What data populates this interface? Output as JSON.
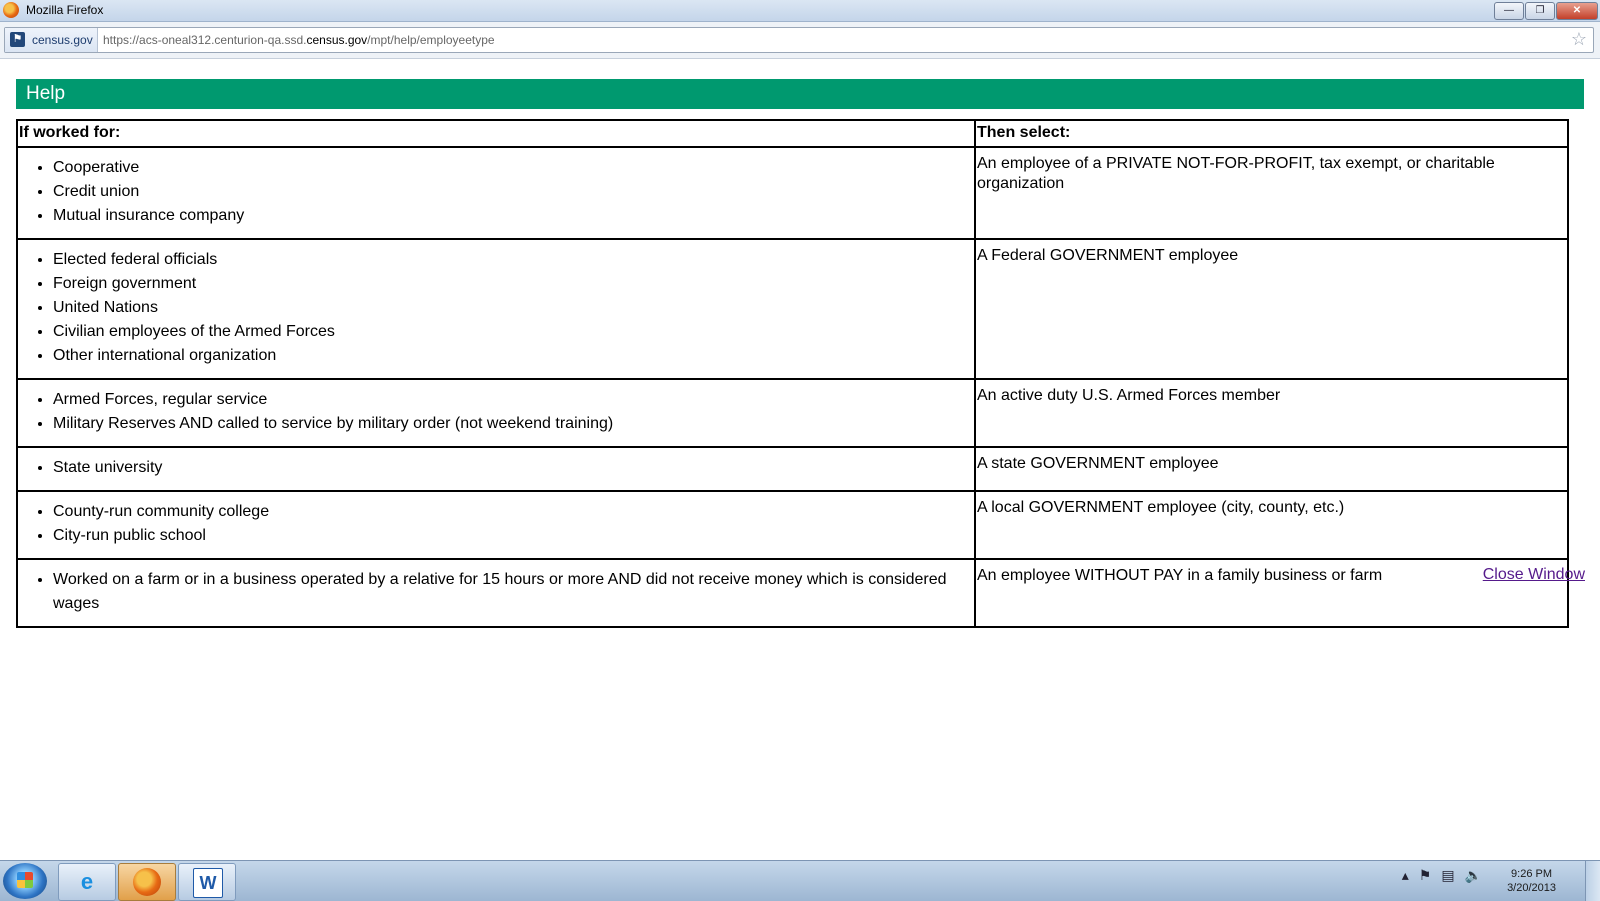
{
  "window": {
    "title": "Mozilla Firefox",
    "controls": {
      "minimize": "—",
      "restore": "❐",
      "close": "✕"
    }
  },
  "browser": {
    "site_identity": "census.gov",
    "url_prefix": "https://acs-oneal312.centurion-qa.ssd.",
    "url_domain": "census.gov",
    "url_path": "/mpt/help/employeetype"
  },
  "page": {
    "header": "Help",
    "table": {
      "col_left": "If worked for:",
      "col_right": "Then select:",
      "rows": [
        {
          "items": [
            "Cooperative",
            "Credit union",
            "Mutual insurance company"
          ],
          "select": "An employee of a PRIVATE NOT-FOR-PROFIT, tax exempt, or charitable organization"
        },
        {
          "items": [
            "Elected federal officials",
            "Foreign government",
            "United Nations",
            "Civilian employees of the Armed Forces",
            "Other international organization"
          ],
          "select": "A Federal GOVERNMENT employee"
        },
        {
          "items": [
            "Armed Forces, regular service",
            "Military Reserves AND called to service by military order (not weekend training)"
          ],
          "select": "An active duty U.S. Armed Forces member"
        },
        {
          "items": [
            "State university"
          ],
          "select": "A state GOVERNMENT employee"
        },
        {
          "items": [
            "County-run community college",
            "City-run public school"
          ],
          "select": "A local GOVERNMENT employee (city, county, etc.)"
        },
        {
          "items": [
            "Worked on a farm or in a business operated by a relative for 15 hours or more AND did not receive money which is considered wages"
          ],
          "select": "An employee WITHOUT PAY in a family business or farm"
        }
      ]
    },
    "close_link": "Close Window"
  },
  "taskbar": {
    "apps": [
      {
        "name": "internet-explorer-icon",
        "glyph": "e"
      },
      {
        "name": "firefox-icon",
        "glyph": ""
      },
      {
        "name": "word-icon",
        "glyph": "W"
      }
    ],
    "time": "9:26 PM",
    "date": "3/20/2013"
  }
}
